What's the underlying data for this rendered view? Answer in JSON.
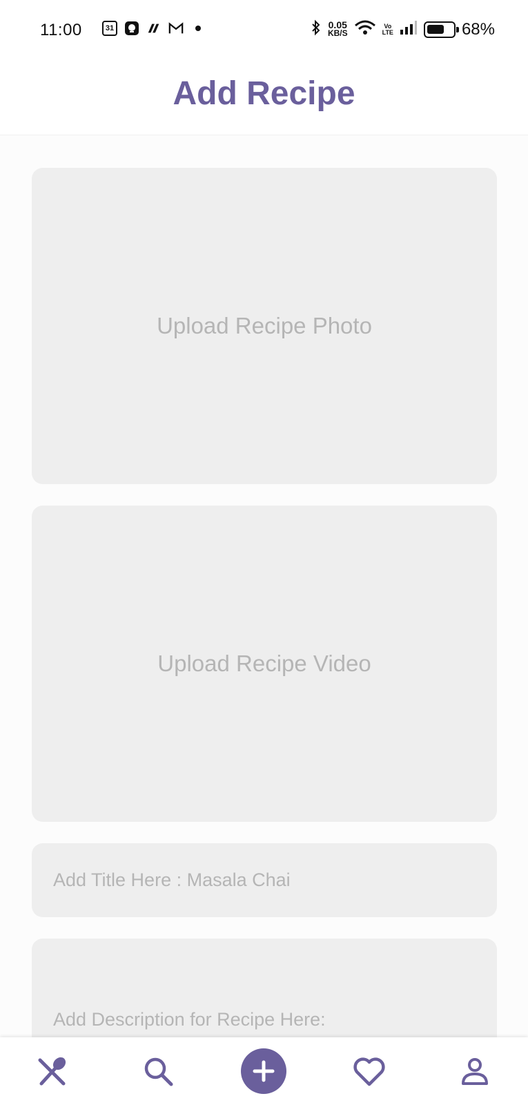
{
  "status_bar": {
    "time": "11:00",
    "calendar_day": "31",
    "net_speed_value": "0.05",
    "net_speed_unit": "KB/S",
    "volte_top": "Vo",
    "volte_bottom": "LTE",
    "battery_level": 0.68,
    "battery_percent": "68%",
    "icons_left": [
      "calendar-icon",
      "notification-app-icon",
      "messaging-app-icon",
      "gmail-icon",
      "more-notifications-dot"
    ],
    "icons_right": [
      "bluetooth-icon",
      "wifi-icon",
      "volte-icon",
      "signal-icon",
      "battery-icon"
    ]
  },
  "header": {
    "title": "Add Recipe"
  },
  "form": {
    "photo_upload_label": "Upload Recipe Photo",
    "video_upload_label": "Upload Recipe Video",
    "title_placeholder": "Add Title Here : Masala Chai",
    "description_placeholder": "Add Description for Recipe Here:"
  },
  "bottom_nav": {
    "items": [
      {
        "name": "home",
        "icon": "utensils-icon"
      },
      {
        "name": "search",
        "icon": "search-icon"
      },
      {
        "name": "add",
        "icon": "plus-icon",
        "active": true
      },
      {
        "name": "favorites",
        "icon": "heart-icon"
      },
      {
        "name": "profile",
        "icon": "user-icon"
      }
    ]
  },
  "colors": {
    "accent": "#6a5f9c",
    "field_background": "#eeeeee",
    "placeholder_text": "#b5b5b5"
  }
}
